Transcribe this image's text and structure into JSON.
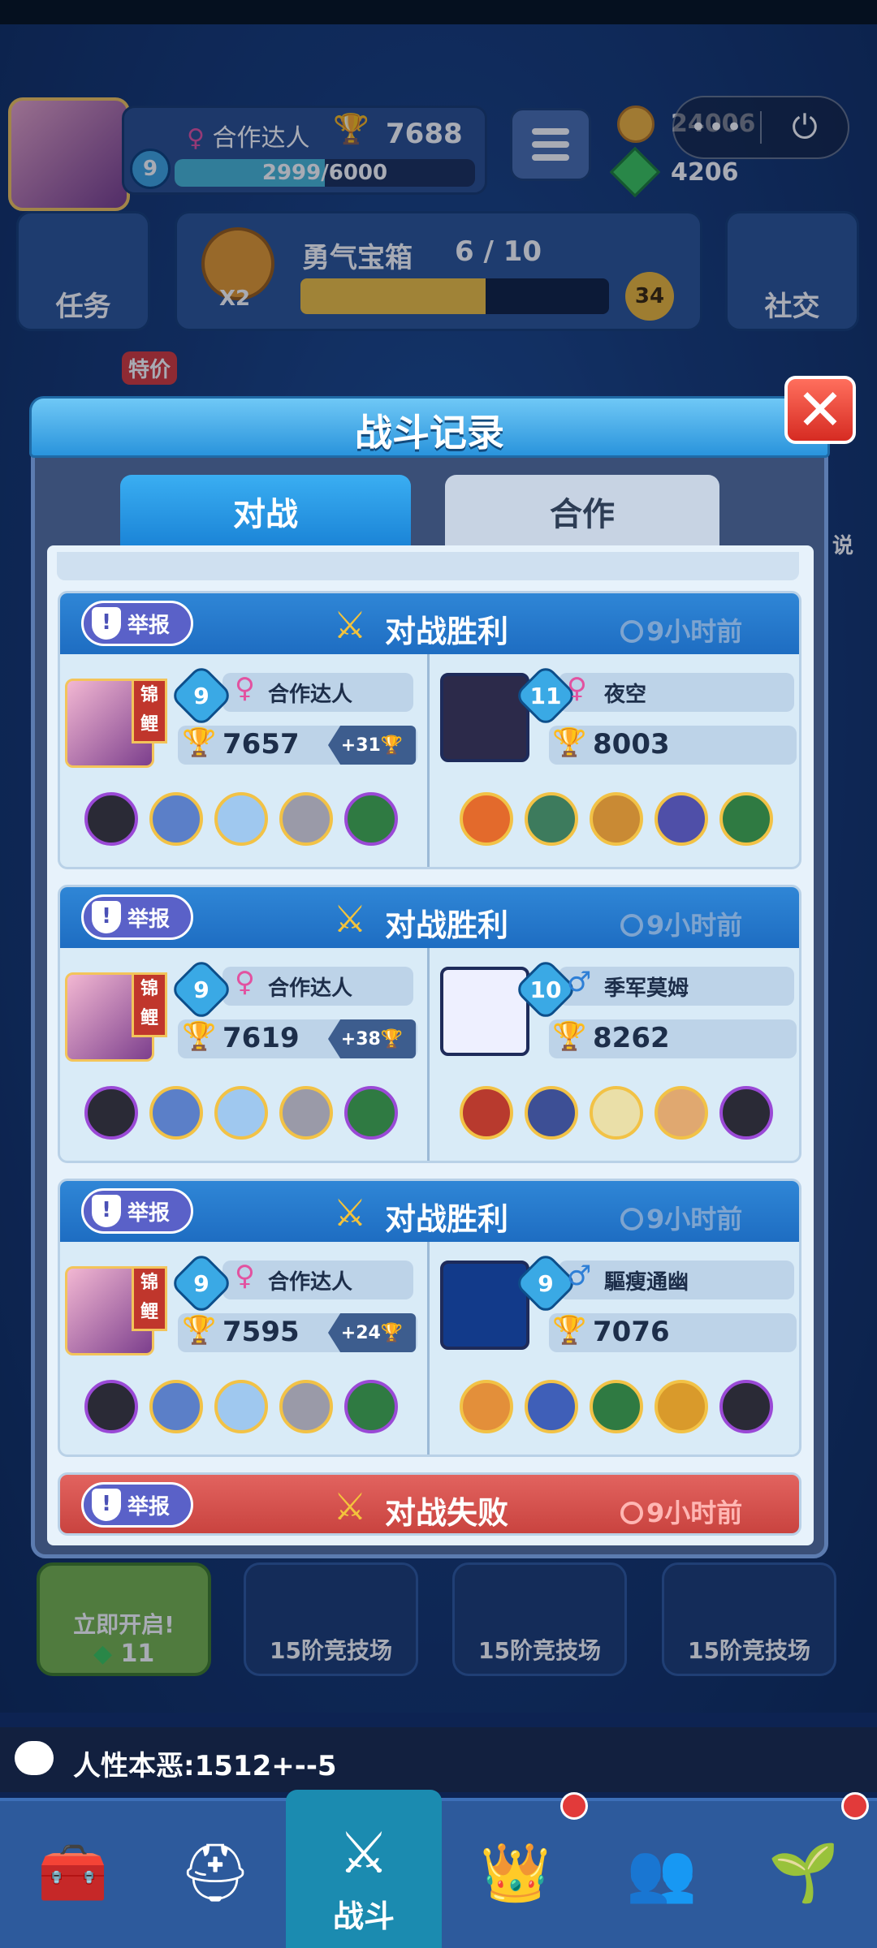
{
  "player": {
    "badge": "锦鲤",
    "name": "合作达人",
    "level": "9",
    "trophies": "7688",
    "xp_text": "2999/6000",
    "xp_progress": 0.4998
  },
  "currency": {
    "coins": "24006",
    "gems": "4206"
  },
  "mini_program": {
    "dots": "•••",
    "power": "⏻"
  },
  "tasks": {
    "label": "任务"
  },
  "brave_chest": {
    "multiplier": "X2",
    "title": "勇气宝箱",
    "count": "6 / 10",
    "progress": 0.6,
    "badge": "34"
  },
  "social": {
    "label": "社交"
  },
  "left_tag": "特价",
  "right_tag": "传说",
  "dialog": {
    "title": "战斗记录",
    "close": "✕",
    "tabs": {
      "versus": "对战",
      "coop": "合作"
    }
  },
  "battles": [
    {
      "report": "举报",
      "result": "对战胜利",
      "time": "9小时前",
      "me": {
        "level": "9",
        "name": "合作达人",
        "trophies": "7657",
        "delta": "+31",
        "badge": "锦鲤"
      },
      "opp": {
        "level": "11",
        "gender": "female",
        "name": "夜空",
        "trophies": "8003"
      }
    },
    {
      "report": "举报",
      "result": "对战胜利",
      "time": "9小时前",
      "me": {
        "level": "9",
        "name": "合作达人",
        "trophies": "7619",
        "delta": "+38",
        "badge": "锦鲤"
      },
      "opp": {
        "level": "10",
        "gender": "male",
        "name": "季军莫姆",
        "trophies": "8262"
      }
    },
    {
      "report": "举报",
      "result": "对战胜利",
      "time": "9小时前",
      "me": {
        "level": "9",
        "name": "合作达人",
        "trophies": "7595",
        "delta": "+24",
        "badge": "锦鲤"
      },
      "opp": {
        "level": "9",
        "gender": "male",
        "name": "驅瘦通幽",
        "trophies": "7076"
      }
    },
    {
      "report": "举报",
      "result": "对战失败",
      "time": "9小时前"
    }
  ],
  "chests": [
    {
      "label": "立即开启!",
      "cost": "11"
    },
    {
      "label": "15阶竞技场"
    },
    {
      "label": "15阶竞技场"
    },
    {
      "label": "15阶竞技场"
    }
  ],
  "chat": {
    "text": "人性本恶:1512+--5"
  },
  "nav": {
    "battle": "战斗"
  },
  "colors": {
    "win_header": "#1e6dc2",
    "lose_header": "#c8423e",
    "accent_blue": "#2a94dc",
    "close_red": "#d62b22"
  }
}
